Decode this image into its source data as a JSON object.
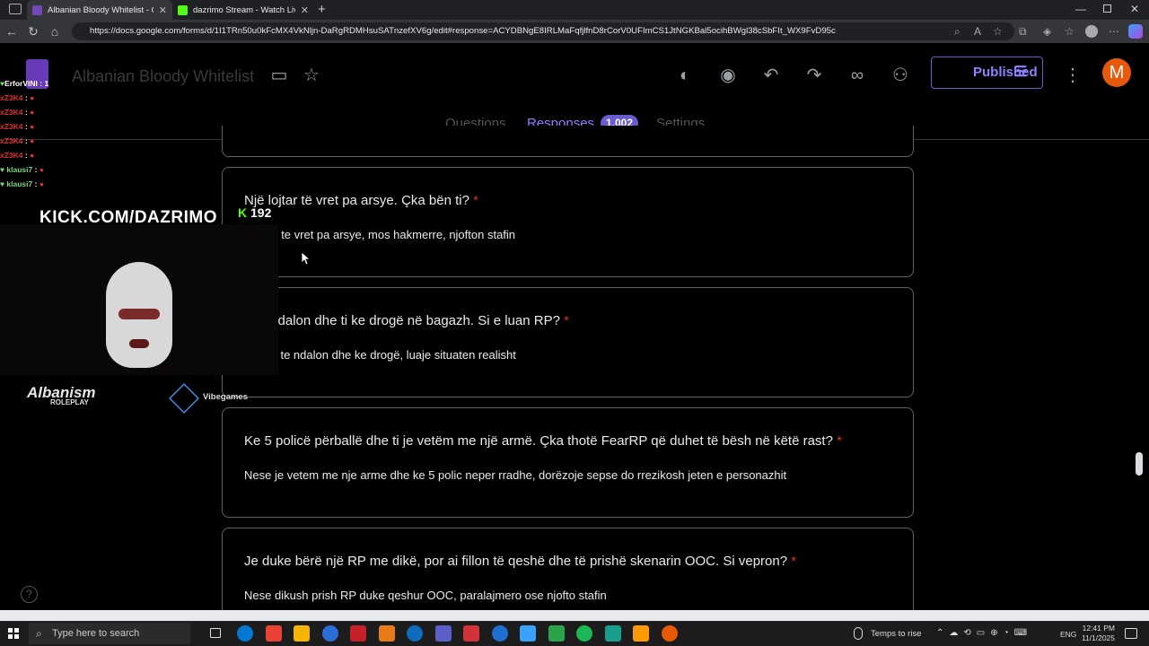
{
  "browser": {
    "tabs": [
      {
        "title": "Albanian Bloody Whitelist - Goog",
        "active": true,
        "favicon_color": "#7248b9"
      },
      {
        "title": "dazrimo Stream - Watch Live on K",
        "active": false,
        "favicon_color": "#53fc18"
      }
    ],
    "url": "https://docs.google.com/forms/d/1I1TRn50u0kFcMX4VkNljn-DaRgRDMHsuSATnzefXV6g/edit#response=ACYDBNgE8IRLMaFqfjlfnD8rCorV0UFImCS1JtNGKBal5ocihBWgl38cSbFIt_WX9FvD95c"
  },
  "form": {
    "title": "Albanian Bloody Whitelist",
    "publish_label": "Published",
    "avatar_letter": "M",
    "tabs": {
      "questions": "Questions",
      "responses": "Responses",
      "settings": "Settings"
    },
    "response_count": "1,002",
    "cards": [
      {
        "question": "Një lojtar të vret pa arsye. Çka bën ti?",
        "required": "*",
        "answer": "dikush te vret pa arsye, mos hakmerre, njofton stafin"
      },
      {
        "question": "a të ndalon dhe ti ke drogë në bagazh. Si e luan RP?",
        "required": "*",
        "answer": "policia te ndalon dhe ke drogë, luaje situaten realisht"
      },
      {
        "question": "Ke 5 policë përballë dhe ti je vetëm me një armë. Çka thotë FearRP që duhet të bësh në këtë rast?",
        "required": "*",
        "answer": "Nese je vetem me nje arme dhe ke 5 polic neper rradhe, dorëzoje sepse do rrezikosh jeten e personazhit"
      },
      {
        "question": "Je duke bërë një RP me dikë, por ai fillon të qeshë dhe të prishë skenarin OOC. Si vepron?",
        "required": "*",
        "answer": "Nese dikush prish RP duke qeshur OOC, paralajmero ose njofto stafin"
      }
    ]
  },
  "overlay": {
    "chat": [
      {
        "user": "ErforVINI",
        "text": ": 1",
        "color": "#ffffff"
      },
      {
        "user": "xZ3K4",
        "text": ":",
        "color": "#e03030"
      },
      {
        "user": "xZ3K4",
        "text": ":",
        "color": "#e03030"
      },
      {
        "user": "xZ3K4",
        "text": ":",
        "color": "#e03030"
      },
      {
        "user": "xZ3K4",
        "text": ":",
        "color": "#e03030"
      },
      {
        "user": "xZ3K4",
        "text": ":",
        "color": "#e03030"
      },
      {
        "user": "klausi7",
        "text": ":",
        "color": "#7bd47b"
      },
      {
        "user": "klausi7",
        "text": ":",
        "color": "#7bd47b"
      }
    ],
    "kick_url": "KICK.COM/DAZRIMO",
    "viewers": "192",
    "logo_main": "Albanism",
    "logo_sub": "ROLEPLAY",
    "sponsor": "Vibegames"
  },
  "taskbar": {
    "search_placeholder": "Type here to search",
    "weather": "Temps to rise",
    "lang": "ENG",
    "time": "12:41 PM",
    "date": "11/1/2025",
    "app_colors": [
      "#0078d4",
      "#ea4335",
      "#f4b400",
      "#2b6fd6",
      "#c6202b",
      "#e77b1a",
      "#0f6cbd",
      "#5b5fc7",
      "#d13438",
      "#1f6fd1",
      "#3ba1ff",
      "#2aa34a",
      "#1db954",
      "#1a9e8c",
      "#ff9b00",
      "#e85a00"
    ]
  }
}
